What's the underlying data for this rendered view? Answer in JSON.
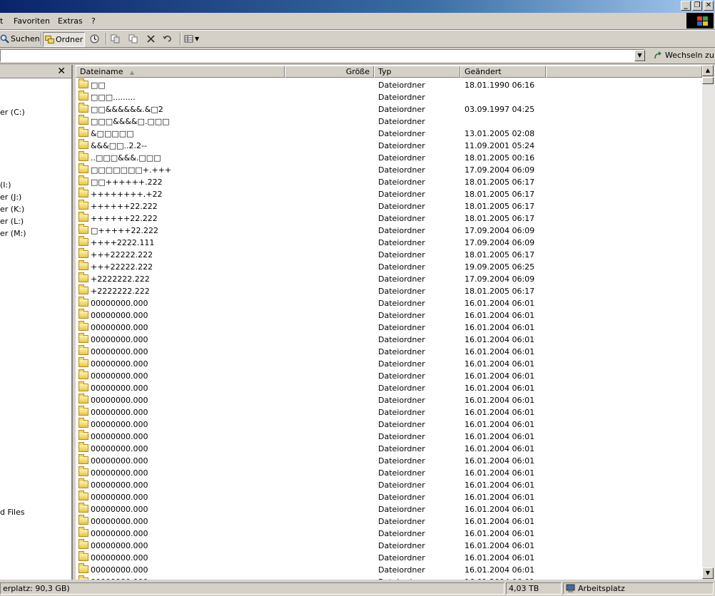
{
  "menu": {
    "items": [
      "t",
      "Favoriten",
      "Extras",
      "?"
    ]
  },
  "toolbar": {
    "search_label": "Suchen",
    "folders_label": "Ordner"
  },
  "address": {
    "value": "",
    "go_label": "Wechseln zu"
  },
  "tree": {
    "items": [
      "er (C:)",
      "(I:)",
      "er (J:)",
      "er (K:)",
      "er (L:)",
      "er (M:)",
      "d Files"
    ]
  },
  "columns": {
    "name": "Dateiname",
    "size": "Größe",
    "type": "Typ",
    "modified": "Geändert"
  },
  "files": [
    {
      "name": "□□",
      "type": "Dateiordner",
      "modified": "18.01.1990 06:16"
    },
    {
      "name": "□□□.........",
      "type": "Dateiordner",
      "modified": ""
    },
    {
      "name": "□□&&&&&&.&□2",
      "type": "Dateiordner",
      "modified": "03.09.1997 04:25"
    },
    {
      "name": "□□□&&&&□.□□□",
      "type": "Dateiordner",
      "modified": ""
    },
    {
      "name": "&□□□□□",
      "type": "Dateiordner",
      "modified": "13.01.2005 02:08"
    },
    {
      "name": "&&&□□..2.2--",
      "type": "Dateiordner",
      "modified": "11.09.2001 05:24"
    },
    {
      "name": "..□□□&&&.□□□",
      "type": "Dateiordner",
      "modified": "18.01.2005 00:16"
    },
    {
      "name": "□□□□□□□+.+++",
      "type": "Dateiordner",
      "modified": "17.09.2004 06:09"
    },
    {
      "name": "□□++++++.222",
      "type": "Dateiordner",
      "modified": "18.01.2005 06:17"
    },
    {
      "name": "++++++++.+22",
      "type": "Dateiordner",
      "modified": "18.01.2005 06:17"
    },
    {
      "name": "++++++22.222",
      "type": "Dateiordner",
      "modified": "18.01.2005 06:17"
    },
    {
      "name": "++++++22.222",
      "type": "Dateiordner",
      "modified": "18.01.2005 06:17"
    },
    {
      "name": "□+++++22.222",
      "type": "Dateiordner",
      "modified": "17.09.2004 06:09"
    },
    {
      "name": "++++2222.111",
      "type": "Dateiordner",
      "modified": "17.09.2004 06:09"
    },
    {
      "name": "+++22222.222",
      "type": "Dateiordner",
      "modified": "18.01.2005 06:17"
    },
    {
      "name": "+++22222.222",
      "type": "Dateiordner",
      "modified": "19.09.2005 06:25"
    },
    {
      "name": "+2222222.222",
      "type": "Dateiordner",
      "modified": "17.09.2004 06:09"
    },
    {
      "name": "+2222222.222",
      "type": "Dateiordner",
      "modified": "18.01.2005 06:17"
    },
    {
      "name": "00000000.000",
      "type": "Dateiordner",
      "modified": "16.01.2004 06:01"
    },
    {
      "name": "00000000.000",
      "type": "Dateiordner",
      "modified": "16.01.2004 06:01"
    },
    {
      "name": "00000000.000",
      "type": "Dateiordner",
      "modified": "16.01.2004 06:01"
    },
    {
      "name": "00000000.000",
      "type": "Dateiordner",
      "modified": "16.01.2004 06:01"
    },
    {
      "name": "00000000.000",
      "type": "Dateiordner",
      "modified": "16.01.2004 06:01"
    },
    {
      "name": "00000000.000",
      "type": "Dateiordner",
      "modified": "16.01.2004 06:01"
    },
    {
      "name": "00000000.000",
      "type": "Dateiordner",
      "modified": "16.01.2004 06:01"
    },
    {
      "name": "00000000.000",
      "type": "Dateiordner",
      "modified": "16.01.2004 06:01"
    },
    {
      "name": "00000000.000",
      "type": "Dateiordner",
      "modified": "16.01.2004 06:01"
    },
    {
      "name": "00000000.000",
      "type": "Dateiordner",
      "modified": "16.01.2004 06:01"
    },
    {
      "name": "00000000.000",
      "type": "Dateiordner",
      "modified": "16.01.2004 06:01"
    },
    {
      "name": "00000000.000",
      "type": "Dateiordner",
      "modified": "16.01.2004 06:01"
    },
    {
      "name": "00000000.000",
      "type": "Dateiordner",
      "modified": "16.01.2004 06:01"
    },
    {
      "name": "00000000.000",
      "type": "Dateiordner",
      "modified": "16.01.2004 06:01"
    },
    {
      "name": "00000000.000",
      "type": "Dateiordner",
      "modified": "16.01.2004 06:01"
    },
    {
      "name": "00000000.000",
      "type": "Dateiordner",
      "modified": "16.01.2004 06:01"
    },
    {
      "name": "00000000.000",
      "type": "Dateiordner",
      "modified": "16.01.2004 06:01"
    },
    {
      "name": "00000000.000",
      "type": "Dateiordner",
      "modified": "16.01.2004 06:01"
    },
    {
      "name": "00000000.000",
      "type": "Dateiordner",
      "modified": "16.01.2004 06:01"
    },
    {
      "name": "00000000.000",
      "type": "Dateiordner",
      "modified": "16.01.2004 06:01"
    },
    {
      "name": "00000000.000",
      "type": "Dateiordner",
      "modified": "16.01.2004 06:01"
    },
    {
      "name": "00000000.000",
      "type": "Dateiordner",
      "modified": "16.01.2004 06:01"
    },
    {
      "name": "00000000.000",
      "type": "Dateiordner",
      "modified": "16.01.2004 06:01"
    },
    {
      "name": "00000000.000",
      "type": "Dateiordner",
      "modified": "16.01.2004 06:01"
    }
  ],
  "status": {
    "free_space": "erplatz: 90,3 GB)",
    "size": "4,03 TB",
    "zone": "Arbeitsplatz"
  }
}
